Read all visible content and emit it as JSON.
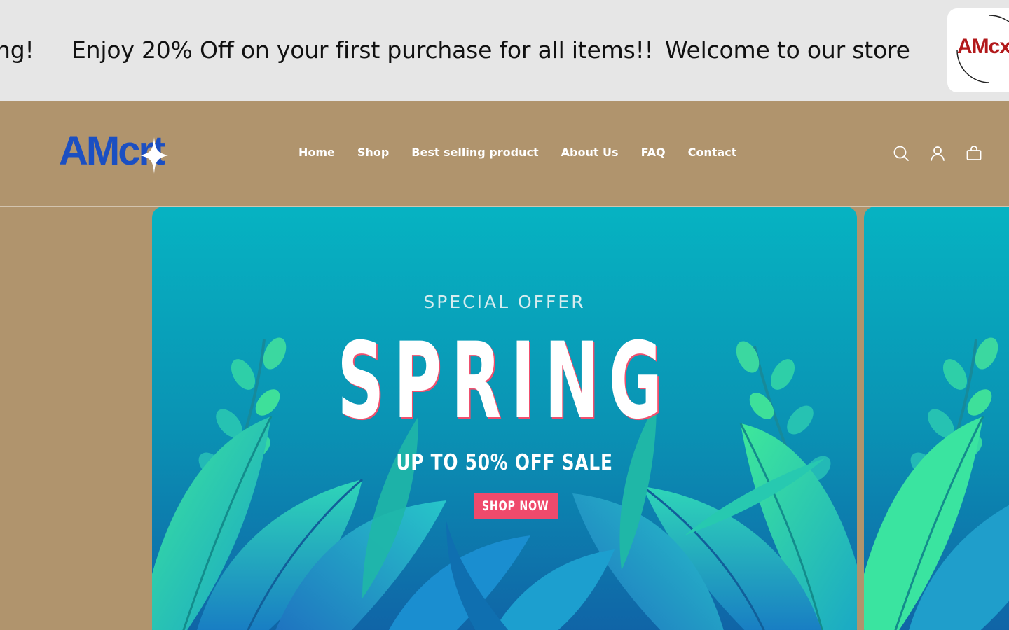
{
  "announcement": {
    "messages": [
      "ng!",
      "Enjoy 20% Off on your first purchase for all items!!",
      "Welcome to our store"
    ],
    "badge_text": "AMcx"
  },
  "header": {
    "brand": "AMcrt",
    "nav": [
      "Home",
      "Shop",
      "Best selling product",
      "About Us",
      "FAQ",
      "Contact"
    ],
    "icons": [
      "search-icon",
      "account-icon",
      "cart-icon"
    ]
  },
  "hero": {
    "subtitle": "SPECIAL OFFER",
    "title": "SPRING",
    "offer": "UP TO 50% OFF SALE",
    "cta": "SHOP NOW"
  },
  "colors": {
    "page_bg": "#b0946d",
    "announce_bg": "#e6e6e6",
    "brand_blue": "#1b4fc2",
    "hero_teal": "#0aa4b8",
    "cta_pink": "#ef4a6c"
  }
}
